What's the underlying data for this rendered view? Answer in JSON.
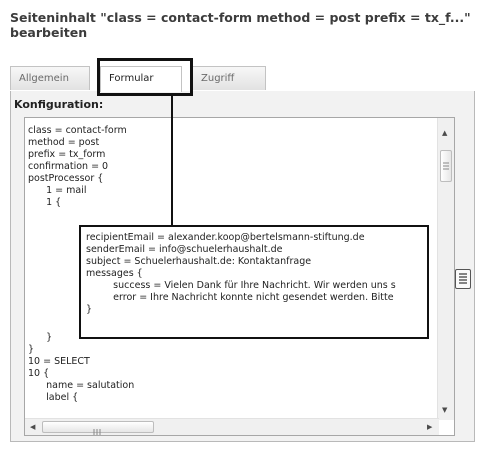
{
  "page": {
    "title": "Seiteninhalt \"class = contact-form method = post prefix = tx_f...\" bearbeiten"
  },
  "tabs": [
    {
      "label": "Allgemein"
    },
    {
      "label": "Formular"
    },
    {
      "label": "Zugriff"
    }
  ],
  "panel": {
    "section_label": "Konfiguration:"
  },
  "editor": {
    "lines_top": "class = contact-form\nmethod = post\nprefix = tx_form\nconfirmation = 0\npostProcessor {\n      1 = mail\n      1 {",
    "lines_bottom": "      }\n}\n10 = SELECT\n10 {\n      name = salutation\n      label {"
  },
  "overlay": {
    "lines": "recipientEmail = alexander.koop@bertelsmann-stiftung.de\nsenderEmail = info@schuelerhaushalt.de\nsubject = Schuelerhaushalt.de: Kontaktanfrage\nmessages {\n         success = Vielen Dank für Ihre Nachricht. Wir werden uns s\n         error = Ihre Nachricht konnte nicht gesendet werden. Bitte\n}"
  },
  "icons": {
    "scroll_up": "up-arrow",
    "scroll_down": "down-arrow",
    "scroll_left": "left-arrow",
    "scroll_right": "right-arrow",
    "fullscreen": "editor-fullscreen-icon"
  }
}
